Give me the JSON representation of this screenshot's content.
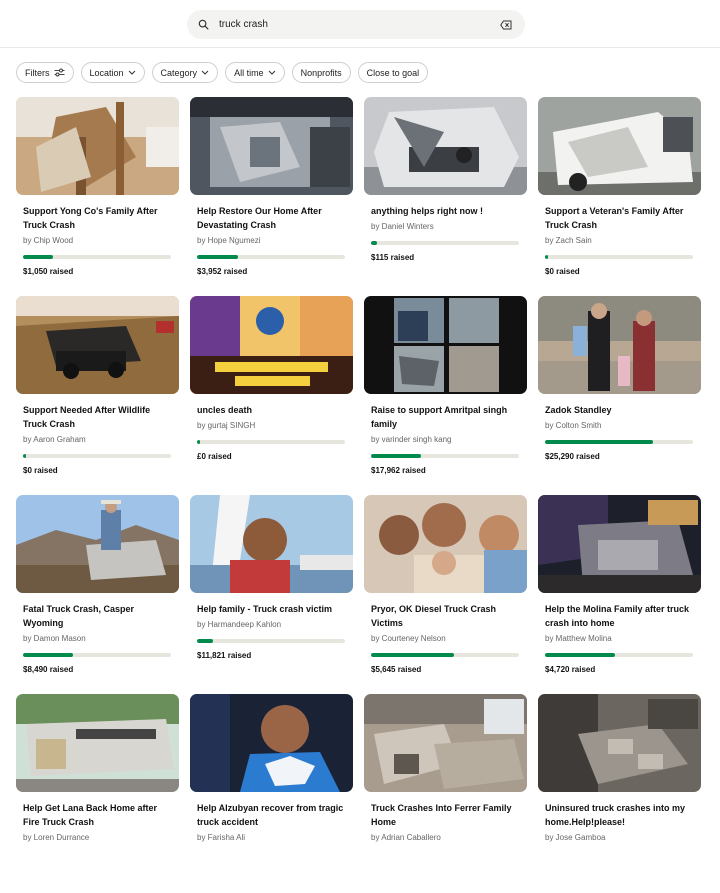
{
  "search": {
    "query": "truck crash"
  },
  "filters": [
    {
      "label": "Filters",
      "icon": "sliders-icon"
    },
    {
      "label": "Location",
      "icon": "chevron-down-icon"
    },
    {
      "label": "Category",
      "icon": "chevron-down-icon"
    },
    {
      "label": "All time",
      "icon": "chevron-down-icon"
    },
    {
      "label": "Nonprofits"
    },
    {
      "label": "Close to goal"
    }
  ],
  "colors": {
    "accent": "#008a4b",
    "track": "#e7e6de"
  },
  "cards": [
    {
      "title": "Support Yong Co's Family After Truck Crash",
      "byline": "by Chip Wood",
      "raised": "$1,050 raised",
      "progress": 0.2,
      "image": "damaged-house-interior"
    },
    {
      "title": "Help Restore Our Home After Devastating Crash",
      "byline": "by Hope Ngumezi",
      "raised": "$3,952 raised",
      "progress": 0.28,
      "image": "truck-in-house"
    },
    {
      "title": "anything helps right now !",
      "byline": "by Daniel Winters",
      "raised": "$115 raised",
      "progress": 0.04,
      "image": "wrecked-truck-front"
    },
    {
      "title": "Support a Veteran's Family After Truck Crash",
      "byline": "by Zach Sain",
      "raised": "$0 raised",
      "progress": 0.01,
      "image": "crushed-white-truck"
    },
    {
      "title": "Support Needed After Wildlife Truck Crash",
      "byline": "by Aaron Graham",
      "raised": "$0 raised",
      "progress": 0.01,
      "image": "crashed-truck-field"
    },
    {
      "title": "uncles death",
      "byline": "by gurtaj SINGH",
      "raised": "£0 raised",
      "progress": 0.01,
      "image": "news-collage"
    },
    {
      "title": "Raise to support Amritpal singh family",
      "byline": "by varinder singh kang",
      "raised": "$17,962 raised",
      "progress": 0.34,
      "image": "photo-collage"
    },
    {
      "title": "Zadok Standley",
      "byline": "by Colton Smith",
      "raised": "$25,290 raised",
      "progress": 0.73,
      "image": "family-walking"
    },
    {
      "title": "Fatal Truck Crash, Casper Wyoming",
      "byline": "by Damon Mason",
      "raised": "$8,490 raised",
      "progress": 0.34,
      "image": "cowboy-horse"
    },
    {
      "title": "Help family - Truck crash victim",
      "byline": "by Harmandeep Kahlon",
      "raised": "$11,821 raised",
      "progress": 0.11,
      "image": "man-selfie-arch"
    },
    {
      "title": "Pryor, OK Diesel Truck Crash Victims",
      "byline": "by Courteney Nelson",
      "raised": "$5,645 raised",
      "progress": 0.56,
      "image": "children-newborn"
    },
    {
      "title": "Help the Molina Family after truck crash into home",
      "byline": "by Matthew Molina",
      "raised": "$4,720 raised",
      "progress": 0.47,
      "image": "truck-night-house"
    },
    {
      "title": "Help Get Lana Back Home after Fire Truck Crash",
      "byline": "by Loren Durrance",
      "raised": "",
      "progress": 0,
      "image": "overturned-fire-truck"
    },
    {
      "title": "Help Alzubyan recover from tragic truck accident",
      "byline": "by Farisha Ali",
      "raised": "",
      "progress": 0,
      "image": "man-portrait-blue"
    },
    {
      "title": "Truck Crashes Into Ferrer Family Home",
      "byline": "by Adrian Caballero",
      "raised": "",
      "progress": 0,
      "image": "debris-room"
    },
    {
      "title": "Uninsured truck crashes into my home.Help!please!",
      "byline": "by Jose Gamboa",
      "raised": "",
      "progress": 0,
      "image": "rubble-blocks"
    }
  ]
}
